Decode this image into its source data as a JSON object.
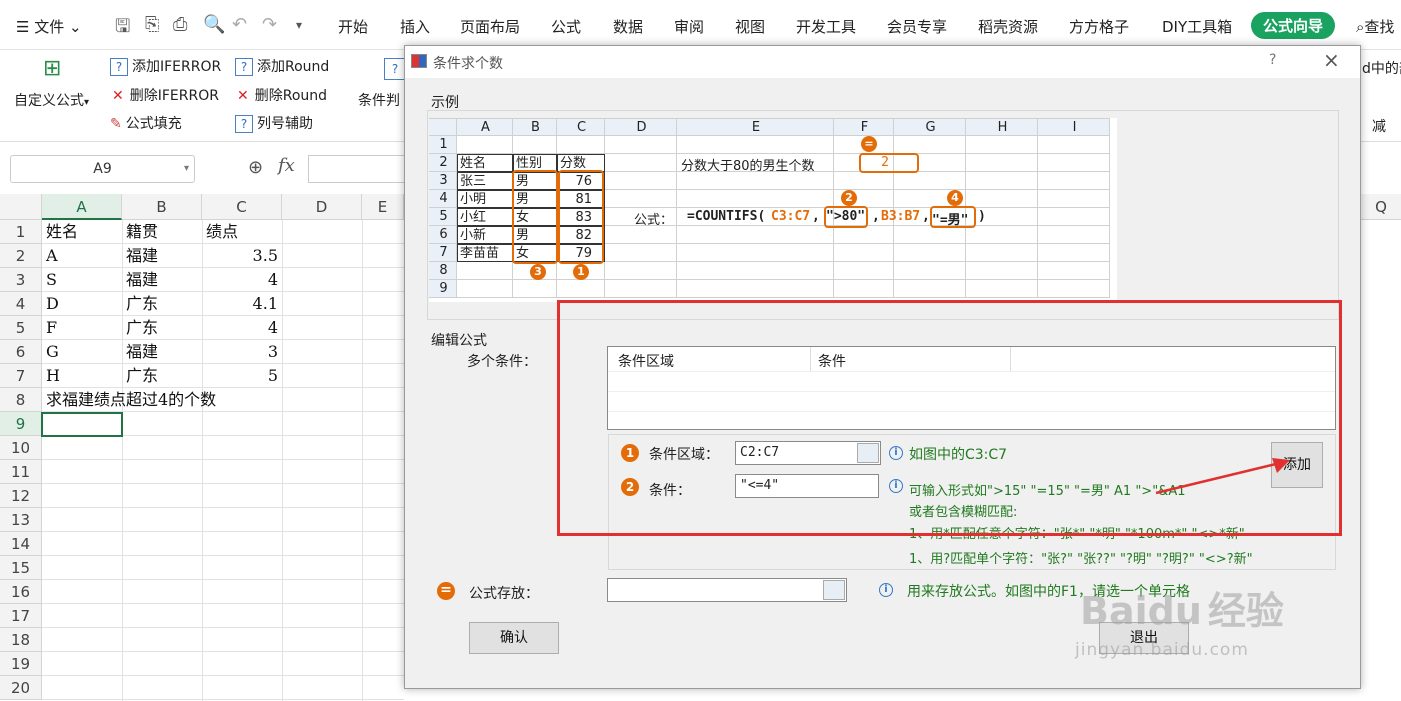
{
  "ribbon_tabs": {
    "file": "文件",
    "start": "开始",
    "insert": "插入",
    "layout": "页面布局",
    "formula": "公式",
    "data": "数据",
    "review": "审阅",
    "view": "视图",
    "dev": "开发工具",
    "member": "会员专享",
    "daoke": "稻壳资源",
    "fangfang": "方方格子",
    "diy": "DIY工具箱",
    "wizard": "公式向导",
    "search": "查找"
  },
  "ribbon": {
    "custom_formula": "自定义公式",
    "add_iferror": "添加IFERROR",
    "del_iferror": "删除IFERROR",
    "formula_fill": "公式填充",
    "add_round": "添加Round",
    "del_round": "删除Round",
    "col_helper": "列号辅助",
    "cond_judge": "条件判",
    "right_cut1": "d中的部",
    "right_cut2": "减"
  },
  "namebox": "A9",
  "fx": "fx",
  "sheet": {
    "columns": [
      "A",
      "B",
      "C",
      "D",
      "E",
      "Q"
    ],
    "rows": [
      "1",
      "2",
      "3",
      "4",
      "5",
      "6",
      "7",
      "8",
      "9",
      "10",
      "11",
      "12",
      "13",
      "14",
      "15",
      "16",
      "17",
      "18",
      "19",
      "20"
    ],
    "data": [
      [
        "姓名",
        "籍贯",
        "绩点"
      ],
      [
        "A",
        "福建",
        "3.5"
      ],
      [
        "S",
        "福建",
        "4"
      ],
      [
        "D",
        "广东",
        "4.1"
      ],
      [
        "F",
        "广东",
        "4"
      ],
      [
        "G",
        "福建",
        "3"
      ],
      [
        "H",
        "广东",
        "5"
      ]
    ],
    "note": "求福建绩点超过4的个数"
  },
  "dialog": {
    "title": "条件求个数",
    "help": "?",
    "close": "×",
    "example_label": "示例",
    "example": {
      "cols": [
        "A",
        "B",
        "C",
        "D",
        "E",
        "F",
        "G",
        "H",
        "I"
      ],
      "rows": [
        "1",
        "2",
        "3",
        "4",
        "5",
        "6",
        "7",
        "8",
        "9"
      ],
      "table": [
        [
          "姓名",
          "性别",
          "分数"
        ],
        [
          "张三",
          "男",
          "76"
        ],
        [
          "小明",
          "男",
          "81"
        ],
        [
          "小红",
          "女",
          "83"
        ],
        [
          "小新",
          "男",
          "82"
        ],
        [
          "李苗苗",
          "女",
          "79"
        ]
      ],
      "question": "分数大于80的男生个数",
      "answer": "2",
      "formula_label": "公式：",
      "formula_pre": "=COUNTIFS(",
      "formula_range1": "C3:C7",
      "formula_comma": ",",
      "formula_crit1": "\">80\"",
      "formula_range2": "B3:B7",
      "formula_crit2": "\"=男\"",
      "formula_end": ")",
      "badges": [
        "=",
        "1",
        "2",
        "3",
        "4"
      ]
    },
    "edit_label": "编辑公式",
    "multi_label": "多个条件：",
    "list_headers": [
      "条件区域",
      "条件"
    ],
    "range_label": "条件区域：",
    "range_value": "C2:C7",
    "range_hint": "如图中的C3:C7",
    "cond_label": "条件：",
    "cond_value": "\"<=4\"",
    "cond_hint1": "可输入形式如\">15\"  \"=15\"  \"=男\"  A1  \">\"&A1",
    "cond_hint2": "或者包含模糊匹配:",
    "cond_hint3": "1、用*匹配任意个字符：\"张*\"  \"*明\"  \"*100m*\"  \"<>*新\"",
    "cond_hint4": "1、用?匹配单个字符：\"张?\"  \"张??\"  \"?明\"  \"?明?\"  \"<>?新\"",
    "add_button": "添加",
    "store_label": "公式存放：",
    "store_hint": "用来存放公式。如图中的F1，请选一个单元格",
    "ok_button": "确认",
    "exit_button": "退出"
  },
  "watermark": {
    "text1": "Baidu",
    "text2": "经验",
    "text3": "jingyan.baidu.com"
  },
  "colors": {
    "accent_green": "#1aa260",
    "highlight_orange": "#e36c09",
    "annot_red": "#e03030",
    "selection": "#217346"
  }
}
